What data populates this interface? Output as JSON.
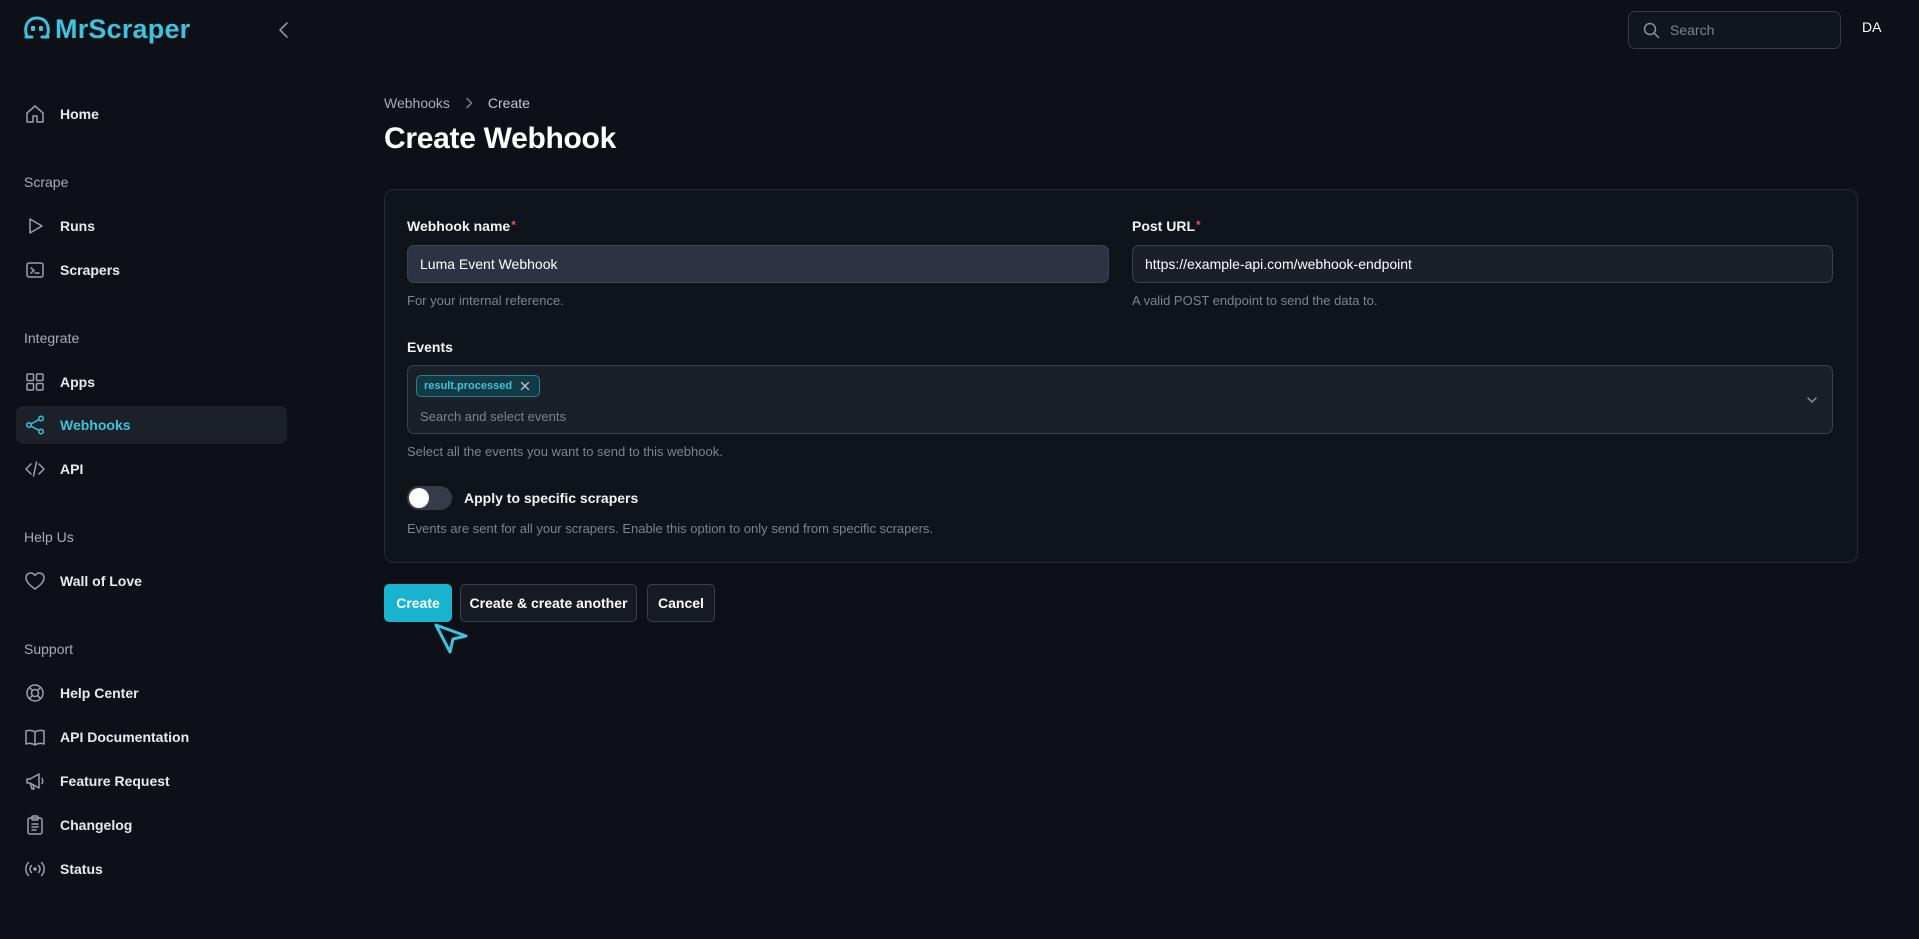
{
  "app": {
    "name": "MrScraper",
    "brand_color": "#3ec3dc",
    "primary_button_color": "#18b3cf"
  },
  "sidebar": {
    "home": {
      "label": "Home",
      "icon": "home-icon"
    },
    "groups": {
      "scrape": "Scrape",
      "integrate": "Integrate",
      "help_us": "Help Us",
      "support": "Support"
    },
    "items": {
      "runs": {
        "label": "Runs",
        "icon": "play-icon"
      },
      "scrapers": {
        "label": "Scrapers",
        "icon": "terminal-icon"
      },
      "apps": {
        "label": "Apps",
        "icon": "grid-icon"
      },
      "webhooks": {
        "label": "Webhooks",
        "icon": "share-icon",
        "active": true
      },
      "api": {
        "label": "API",
        "icon": "code-icon"
      },
      "wall_of_love": {
        "label": "Wall of Love",
        "icon": "heart-icon"
      },
      "help_center": {
        "label": "Help Center",
        "icon": "lifebuoy-icon"
      },
      "api_documentation": {
        "label": "API Documentation",
        "icon": "book-icon"
      },
      "feature_request": {
        "label": "Feature Request",
        "icon": "megaphone-icon"
      },
      "changelog": {
        "label": "Changelog",
        "icon": "clipboard-icon"
      },
      "status": {
        "label": "Status",
        "icon": "signal-icon"
      }
    }
  },
  "topbar": {
    "search_placeholder": "Search",
    "avatar_initials": "DA"
  },
  "breadcrumb": {
    "parent": "Webhooks",
    "current": "Create"
  },
  "page": {
    "title": "Create Webhook"
  },
  "form": {
    "webhook_name": {
      "label": "Webhook name",
      "required_mark": "*",
      "value": "Luma Event Webhook",
      "hint": "For your internal reference."
    },
    "post_url": {
      "label": "Post URL",
      "required_mark": "*",
      "value": "https://example-api.com/webhook-endpoint",
      "hint": "A valid POST endpoint to send the data to."
    },
    "events": {
      "label": "Events",
      "selected": [
        "result.processed"
      ],
      "placeholder": "Search and select events",
      "hint": "Select all the events you want to send to this webhook."
    },
    "apply_specific": {
      "label": "Apply to specific scrapers",
      "enabled": false,
      "hint": "Events are sent for all your scrapers. Enable this option to only send from specific scrapers."
    }
  },
  "actions": {
    "create": "Create",
    "create_another": "Create & create another",
    "cancel": "Cancel"
  }
}
